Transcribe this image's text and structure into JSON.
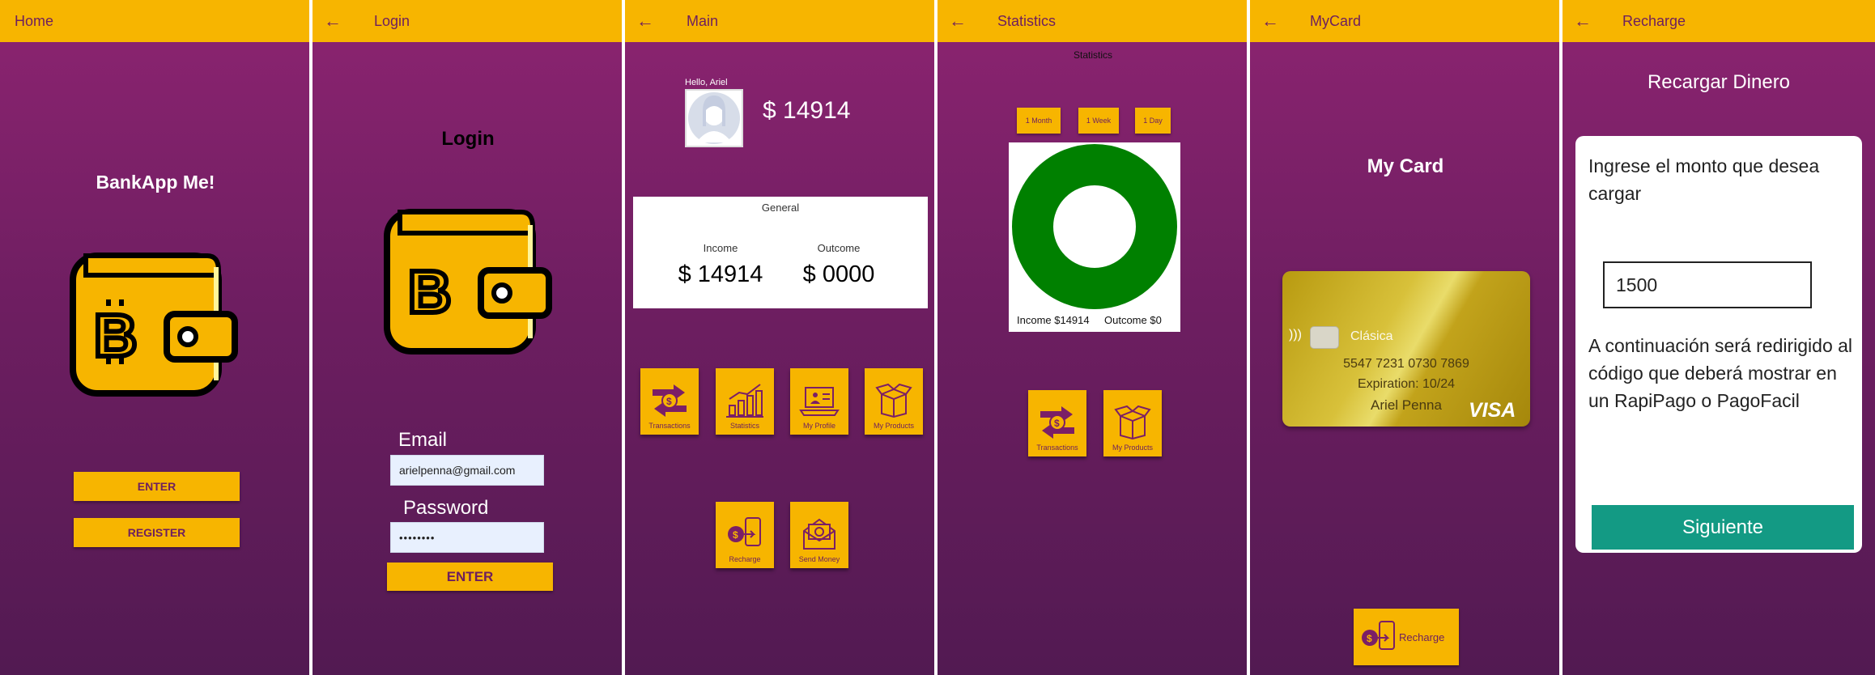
{
  "screens": {
    "home": {
      "title": "Home",
      "app_name": "BankApp Me!",
      "enter_label": "ENTER",
      "register_label": "REGISTER"
    },
    "login": {
      "title": "Login",
      "heading": "Login",
      "email_label": "Email",
      "email_value": "arielpenna@gmail.com",
      "password_label": "Password",
      "password_value": "••••••••",
      "enter_label": "ENTER"
    },
    "main": {
      "title": "Main",
      "greeting": "Hello, Ariel",
      "balance": "$ 14914",
      "general_title": "General",
      "income_label": "Income",
      "outcome_label": "Outcome",
      "income_value": "$ 14914",
      "outcome_value": "$ 0000",
      "tiles": [
        "Transactions",
        "Statistics",
        "My Profile",
        "My Products",
        "Recharge",
        "Send Money"
      ]
    },
    "statistics": {
      "title": "Statistics",
      "subtitle": "Statistics",
      "filters": [
        "1 Month",
        "1 Week",
        "1 Day"
      ],
      "chart_caption_income": "Income $14914",
      "chart_caption_outcome": "Outcome $0",
      "tiles": [
        "Transactions",
        "My Products"
      ]
    },
    "mycard": {
      "title": "MyCard",
      "heading": "My Card",
      "card_type": "Clásica",
      "card_number": "5547 7231 0730 7869",
      "expiration": "Expiration: 10/24",
      "holder": "Ariel Penna",
      "brand": "VISA",
      "recharge_label": "Recharge"
    },
    "recharge": {
      "title": "Recharge",
      "heading": "Recargar Dinero",
      "prompt": "Ingrese el monto que desea cargar",
      "amount_value": "1500",
      "info": "A continuación será redirigido al código que deberá mostrar en un RapiPago o PagoFacil",
      "next_label": "Siguiente"
    }
  },
  "colors": {
    "appbar": "#f7b500",
    "purple": "#6d1f5f",
    "background_top": "#8d2471",
    "background_bottom": "#521a52",
    "donut_income": "#008000",
    "next_button": "#139a84"
  },
  "chart_data": {
    "type": "pie",
    "categories": [
      "Income",
      "Outcome"
    ],
    "values": [
      14914,
      0
    ]
  }
}
